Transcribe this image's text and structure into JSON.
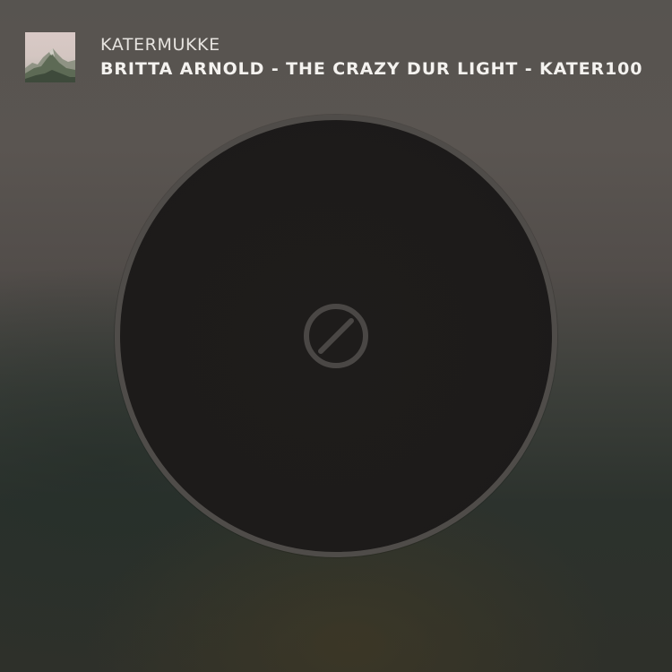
{
  "now_playing": {
    "station": "KATERMUKKE",
    "track_title": "BRITTA ARNOLD - THE CRAZY DUR LIGHT - KATER100",
    "album_art_icon": "mountain-landscape-thumbnail"
  },
  "player": {
    "center_icon": "disabled-icon",
    "disc_color": "#1e1c1b",
    "ring_color": "#4f4c49",
    "icon_color": "#4a4745"
  }
}
